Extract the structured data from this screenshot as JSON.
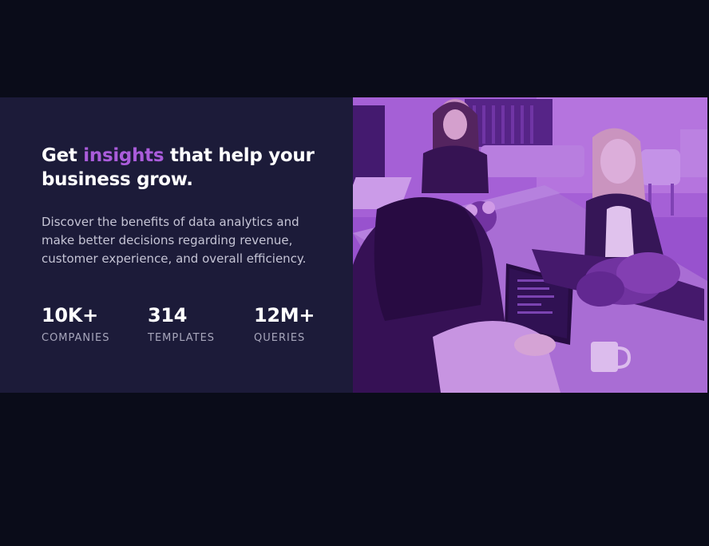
{
  "hero": {
    "title_prefix": "Get",
    "title_highlight": "insights",
    "title_suffix": "that help your business grow.",
    "description": "Discover the benefits of data analytics and make better decisions regarding revenue, customer experience, and overall efficiency."
  },
  "stats": [
    {
      "value": "10K+",
      "label": "COMPANIES"
    },
    {
      "value": "314",
      "label": "TEMPLATES"
    },
    {
      "value": "12M+",
      "label": "QUERIES"
    }
  ],
  "image": {
    "subject": "people-working-at-office-desk-photo",
    "tint_color": "#aa5cdb"
  },
  "colors": {
    "page_background": "#0a0c19",
    "card_background": "#1c1b39",
    "accent": "#aa5cdb",
    "heading_text": "#ffffff",
    "body_text": "#c5c4d5",
    "label_text": "#a7a6bb"
  }
}
